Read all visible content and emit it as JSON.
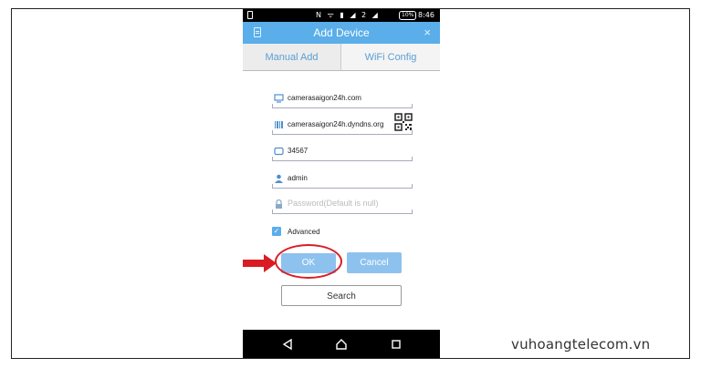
{
  "status_bar": {
    "icons": "N ᯤ ▮ ◢ 2 ◢",
    "battery": "10%",
    "time": "8:46"
  },
  "title_bar": {
    "title": "Add Device",
    "menu_icon": "list-icon",
    "close_icon": "close-icon",
    "close_glyph": "×"
  },
  "tabs": [
    "Manual Add",
    "WiFi Config"
  ],
  "form": {
    "domain": "camerasaigon24h.com",
    "serial": "camerasaigon24h.dyndns.org",
    "port": "34567",
    "username": "admin",
    "password_placeholder": "Password(Default is null)",
    "advanced_label": "Advanced",
    "advanced_checked": true
  },
  "buttons": {
    "ok": "OK",
    "cancel": "Cancel",
    "search": "Search"
  },
  "nav_bar": [
    "back-icon",
    "home-icon",
    "recents-icon"
  ],
  "annotation": {
    "arrow_color": "#d91c24",
    "ring_color": "#d91c24"
  },
  "watermark": "vuhoangtelecom.vn",
  "colors": {
    "accent": "#5aaee9",
    "button": "#8ec2ee",
    "tab_text": "#5a9fd3"
  }
}
